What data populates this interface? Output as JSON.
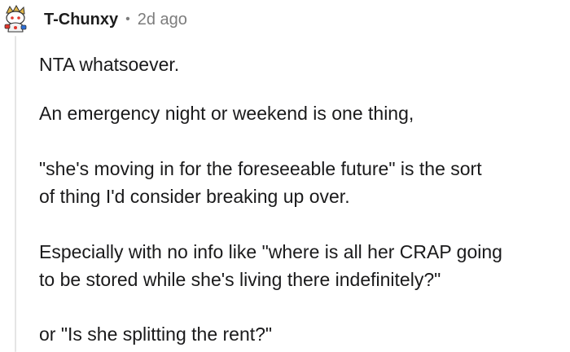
{
  "comment": {
    "author": "T-Chunxy",
    "separator": "•",
    "time_ago": "2d ago",
    "avatar_icon": "snoo-avatar-icon",
    "paragraphs": [
      {
        "lines": [
          "NTA whatsoever."
        ]
      },
      {
        "lines": [
          "An emergency night or weekend is one thing,"
        ]
      },
      {
        "lines": [
          "\"she's moving in for the foreseeable future\" is the sort",
          "of thing I'd consider breaking up over."
        ]
      },
      {
        "lines": [
          "Especially with no info like \"where is all her CRAP going",
          "to be stored while she's living there indefinitely?\""
        ]
      },
      {
        "lines": [
          "or \"Is she splitting the rent?\""
        ]
      }
    ]
  },
  "colors": {
    "text": "#1a1a1b",
    "meta": "#7c7c7c",
    "thread_line": "#e5e5e5"
  }
}
